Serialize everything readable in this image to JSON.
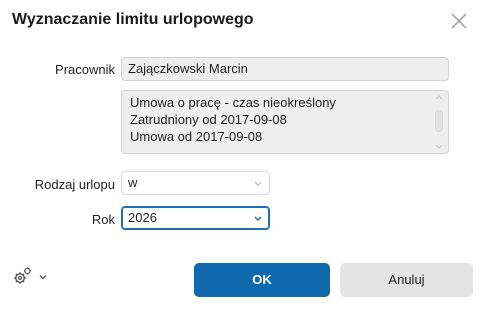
{
  "dialog": {
    "title": "Wyznaczanie limitu urlopowego",
    "close_icon": "close-icon"
  },
  "employee": {
    "label": "Pracownik",
    "value": "Zajączkowski Marcin"
  },
  "contract_info": {
    "lines": [
      "Umowa o pracę - czas nieokreślony",
      "Zatrudniony od 2017-09-08",
      "Umowa od 2017-09-08"
    ]
  },
  "leave_type": {
    "label": "Rodzaj urlopu",
    "value": "w"
  },
  "year": {
    "label": "Rok",
    "value": "2026"
  },
  "footer": {
    "settings_icon": "gear-icon",
    "ok_label": "OK",
    "cancel_label": "Anuluj"
  },
  "colors": {
    "primary": "#0e6aad",
    "focus": "#1f6fb2"
  }
}
